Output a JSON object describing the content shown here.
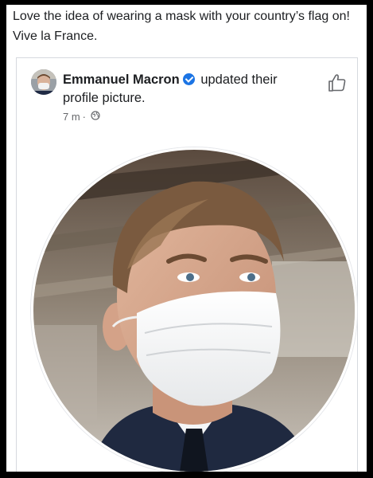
{
  "post": {
    "caption": "Love the idea of wearing a mask with your country’s flag on! Vive la France."
  },
  "shared_post": {
    "author": "Emmanuel Macron",
    "action_text": "updated their profile picture.",
    "time": "7 m",
    "separator": "·",
    "privacy_icon": "globe-icon",
    "verified_icon": "verified-badge-icon",
    "like_icon": "thumbs-up-icon"
  },
  "colors": {
    "verified_blue": "#1b74e4",
    "text": "#1c1e21",
    "secondary_text": "#65676b"
  }
}
